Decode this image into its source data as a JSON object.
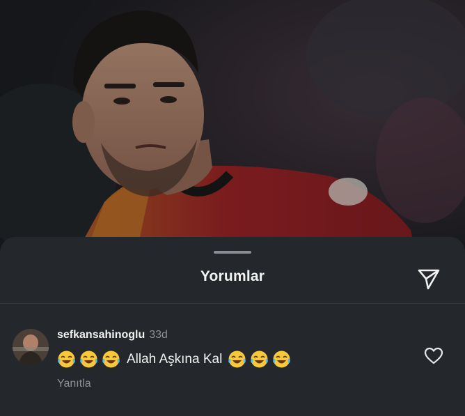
{
  "background": {
    "icon": "photo-football-player"
  },
  "sheet": {
    "title": "Yorumlar",
    "share_icon": "send-icon"
  },
  "comment": {
    "username": "sefkansahinoglu",
    "time": "33d",
    "emoji_before": [
      "😂",
      "😂",
      "😂"
    ],
    "text": "Allah Aşkına Kal",
    "emoji_after": [
      "😂",
      "😂",
      "😂"
    ],
    "reply_label": "Yanıtla",
    "like_icon": "heart-outline-icon"
  },
  "colors": {
    "sheet_bg": "#24272b",
    "text_primary": "#f2f2f2",
    "text_secondary": "#8d9095",
    "jersey_red": "#b3262a",
    "jersey_orange": "#c9782a"
  }
}
